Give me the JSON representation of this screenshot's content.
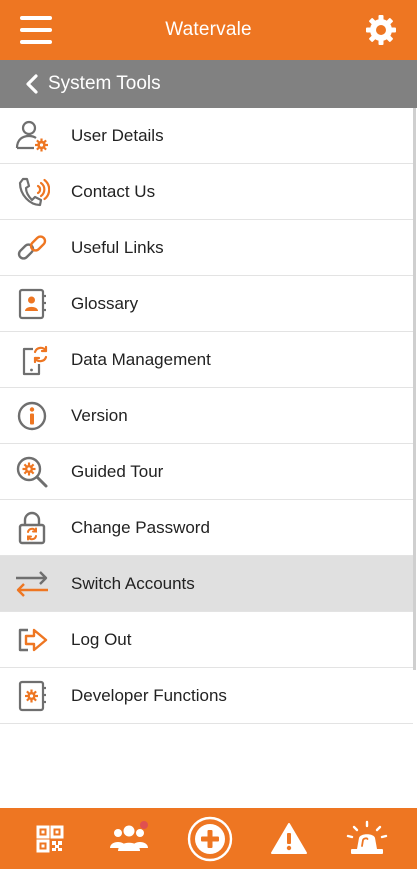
{
  "app": {
    "title": "Watervale",
    "accent_color": "#ee7622",
    "subheader_color": "#818181"
  },
  "subheader": {
    "back_icon": "chevron-left-icon",
    "title": "System Tools"
  },
  "menu": [
    {
      "label": "User Details",
      "icon": "user-gear-icon",
      "selected": false
    },
    {
      "label": "Contact Us",
      "icon": "phone-icon",
      "selected": false
    },
    {
      "label": "Useful Links",
      "icon": "link-icon",
      "selected": false
    },
    {
      "label": "Glossary",
      "icon": "address-book-icon",
      "selected": false
    },
    {
      "label": "Data Management",
      "icon": "mobile-sync-icon",
      "selected": false
    },
    {
      "label": "Version",
      "icon": "info-icon",
      "selected": false
    },
    {
      "label": "Guided Tour",
      "icon": "magnifier-gear-icon",
      "selected": false
    },
    {
      "label": "Change Password",
      "icon": "lock-refresh-icon",
      "selected": false
    },
    {
      "label": "Switch Accounts",
      "icon": "swap-arrows-icon",
      "selected": true
    },
    {
      "label": "Log Out",
      "icon": "logout-arrow-icon",
      "selected": false
    },
    {
      "label": "Developer Functions",
      "icon": "notebook-gear-icon",
      "selected": false
    }
  ],
  "bottom_nav": [
    {
      "icon": "qr-code-icon"
    },
    {
      "icon": "users-group-icon",
      "badge_color": "#e05050"
    },
    {
      "icon": "add-circle-icon"
    },
    {
      "icon": "warning-icon"
    },
    {
      "icon": "siren-icon"
    }
  ]
}
